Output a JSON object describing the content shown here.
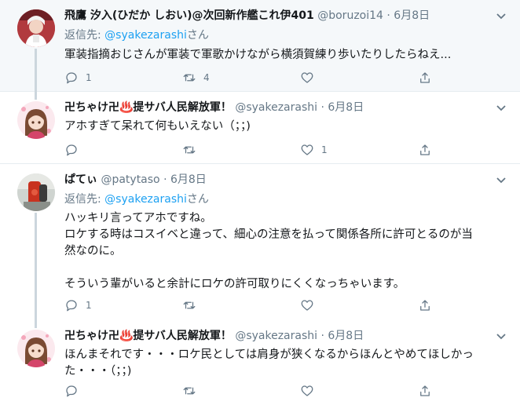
{
  "tweets": [
    {
      "name": "飛鷹 汐入(ひだか しおい)@次回新作艦これ伊401",
      "handle": "@boruzoi14",
      "dot": "·",
      "date": "6月8日",
      "reply_prefix": "返信先: ",
      "reply_mention": "@syakezarashi",
      "reply_suffix": "さん",
      "text": "軍装指摘おじさんが軍装で軍歌かけながら横須賀練り歩いたりしたらねえ...",
      "replies": "1",
      "retweets": "4",
      "likes": ""
    },
    {
      "name": "卍ちゃけ卍♨️提サバ人民解放軍！",
      "handle": "@syakezarashi",
      "dot": "·",
      "date": "6月8日",
      "text": "アホすぎて呆れて何もいえない（；；)",
      "replies": "",
      "retweets": "",
      "likes": "1"
    },
    {
      "name": "ぱてぃ",
      "handle": "@patytaso",
      "dot": "·",
      "date": "6月8日",
      "reply_prefix": "返信先: ",
      "reply_mention": "@syakezarashi",
      "reply_suffix": "さん",
      "text": "ハッキリ言ってアホですね。\nロケする時はコスイベと違って、細心の注意を払って関係各所に許可とるのが当\n然なのに。\n\nそういう輩がいると余計にロケの許可取りにくくなっちゃいます。",
      "replies": "1",
      "retweets": "",
      "likes": ""
    },
    {
      "name": "卍ちゃけ卍♨️提サバ人民解放軍！",
      "handle": "@syakezarashi",
      "dot": "·",
      "date": "6月8日",
      "text": "ほんまそれです・・・ロケ民としては肩身が狭くなるからほんとやめてほしかっ\nた・・・（；；)",
      "replies": "",
      "retweets": "",
      "likes": ""
    }
  ],
  "icons": {
    "reply": "reply-icon",
    "retweet": "retweet-icon",
    "like": "heart-icon",
    "share": "share-icon",
    "menu": "chevron-down-icon"
  },
  "colors": {
    "link": "#1da1f2",
    "muted": "#657786",
    "highlight_bg": "#f5f8fa",
    "thread_line": "#ccd6dd"
  }
}
